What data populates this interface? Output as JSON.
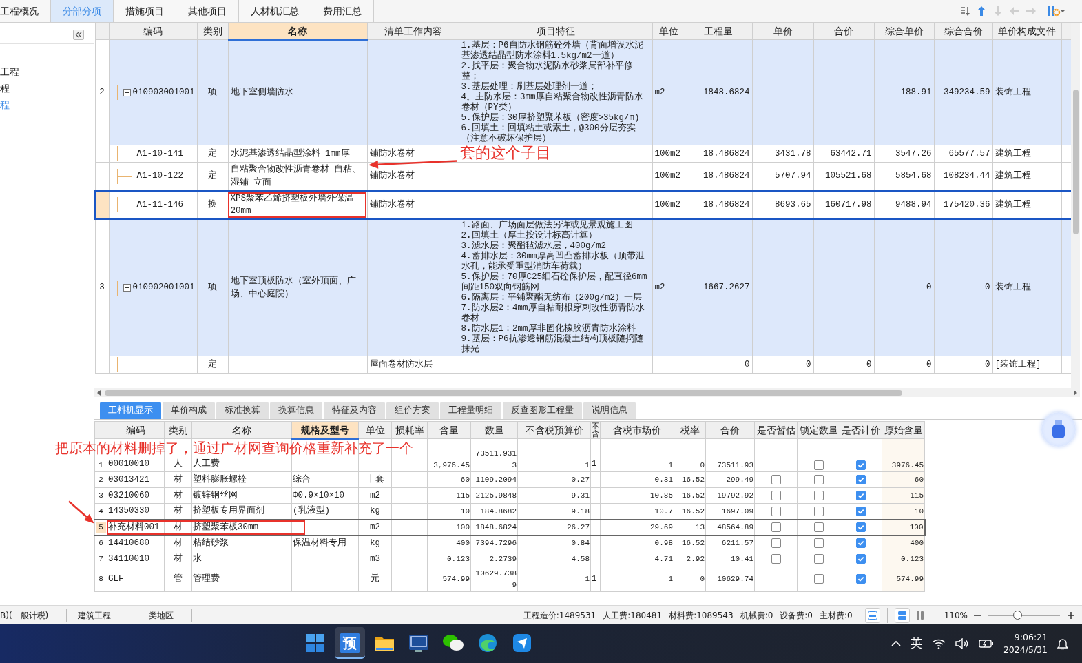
{
  "tabs": [
    {
      "label": "工程概况",
      "selected": false
    },
    {
      "label": "分部分项",
      "selected": true
    },
    {
      "label": "措施项目",
      "selected": false
    },
    {
      "label": "其他项目",
      "selected": false
    },
    {
      "label": "人材机汇总",
      "selected": false
    },
    {
      "label": "费用汇总",
      "selected": false
    }
  ],
  "toolbar": [
    {
      "kind": "sort"
    },
    {
      "kind": "up",
      "disabled": false
    },
    {
      "kind": "down",
      "disabled": true
    },
    {
      "kind": "left",
      "disabled": true
    },
    {
      "kind": "right",
      "disabled": true
    },
    {
      "kind": "settings"
    }
  ],
  "sidebar": {
    "items": [
      {
        "label": "工程",
        "selected": false
      },
      {
        "label": "程",
        "selected": false
      },
      {
        "label": "程",
        "selected": true
      }
    ]
  },
  "main_table": {
    "columns": [
      {
        "label": "编码",
        "highlighted": false
      },
      {
        "label": "类别",
        "highlighted": false
      },
      {
        "label": "名称",
        "highlighted": true
      },
      {
        "label": "清单工作内容",
        "highlighted": false
      },
      {
        "label": "项目特征",
        "highlighted": false
      },
      {
        "label": "单位",
        "highlighted": false
      },
      {
        "label": "工程量",
        "highlighted": false
      },
      {
        "label": "单价",
        "highlighted": false
      },
      {
        "label": "合价",
        "highlighted": false
      },
      {
        "label": "综合单价",
        "highlighted": false
      },
      {
        "label": "综合合价",
        "highlighted": false
      },
      {
        "label": "单价构成文件",
        "highlighted": false
      }
    ],
    "rows": [
      {
        "no": "2",
        "code": "010903001001",
        "type": "项",
        "name": "地下室侧墙防水",
        "features": [
          "1.基层：P6自防水钢筋砼外墙（背面增设水泥基渗透结晶型防水涂料1.5kg/m2一道）",
          "2.找平层：聚合物水泥防水砂浆局部补平修整；",
          "3.基层处理：刷基层处理剂一道；",
          "4。主防水层：3mm厚自粘聚合物改性沥青防水卷材（PY类）",
          "5.保护层：30厚挤塑聚苯板（密度>35kg/m)",
          "6.回填土：回填粘土或素土，@300分层夯实（注意不破坏保护层）"
        ],
        "unit": "m2",
        "qty": "1848.6824",
        "unit_total": "188.91",
        "total_total": "349234.59",
        "file": "装饰工程",
        "expanded": true,
        "selected": false,
        "children": [
          {
            "code": "A1-10-141",
            "type": "定",
            "name": "水泥基渗透结晶型涂料 1mm厚",
            "work": "铺防水卷材",
            "unit": "100m2",
            "qty": "18.486824",
            "price": "3431.78",
            "total": "63442.71",
            "unit_total": "3547.26",
            "total_total": "65577.57",
            "file": "建筑工程",
            "selected": false
          },
          {
            "code": "A1-10-122",
            "type": "定",
            "name": "自粘聚合物改性沥青卷材 自粘、湿铺 立面",
            "work": "铺防水卷材",
            "unit": "100m2",
            "qty": "18.486824",
            "price": "5707.94",
            "total": "105521.68",
            "unit_total": "5854.68",
            "total_total": "108234.44",
            "file": "建筑工程",
            "selected": false
          },
          {
            "code": "A1-11-146",
            "type": "换",
            "name": "XPS聚苯乙烯挤塑板外墙外保温 20mm",
            "work": "铺防水卷材",
            "unit": "100m2",
            "qty": "18.486824",
            "price": "8693.65",
            "total": "160717.98",
            "unit_total": "9488.94",
            "total_total": "175420.36",
            "file": "建筑工程",
            "selected": true
          }
        ]
      },
      {
        "no": "3",
        "code": "010902001001",
        "type": "项",
        "name": "地下室顶板防水（室外顶面、广场、中心庭院）",
        "features": [
          "1.路面、广场面层做法另详或见景观施工图",
          "2.回填土（厚土按设计标高计算）",
          "3.滤水层：聚酯毡滤水层，400g/m2",
          "4.蓄排水层：30mm厚高凹凸蓄排水板（顶带泄水孔，能承受重型消防车荷载）",
          "5.保护层：70厚C25细石砼保护层，配直径6mm间距150双向钢筋网",
          "6.隔离层：平铺聚酯无纺布（200g/m2）一层",
          "7.防水层2：4mm厚自粘耐根穿刺改性沥青防水卷材",
          "8.防水层1：2mm厚非固化橡胶沥青防水涂料",
          "9.基层：P6抗渗透钢筋混凝土结构顶板随捣随抹光"
        ],
        "unit": "m2",
        "qty": "1667.2627",
        "unit_total": "0",
        "total_total": "0",
        "file": "装饰工程",
        "expanded": true,
        "selected": false,
        "children": [
          {
            "type": "定",
            "work": "屋面卷材防水层",
            "qty": "0",
            "price": "0",
            "total": "0",
            "unit_total": "0",
            "total_total": "0",
            "file": "[装饰工程]",
            "selected": false
          }
        ]
      }
    ]
  },
  "annotations": [
    {
      "kind": "callout",
      "text": "套的这个子目"
    },
    {
      "kind": "callout",
      "text": "把原本的材料删掉了，通过广材网查询价格重新补充了一个"
    }
  ],
  "detail_tabs": [
    {
      "label": "工料机显示",
      "selected": true
    },
    {
      "label": "单价构成",
      "selected": false
    },
    {
      "label": "标准换算",
      "selected": false
    },
    {
      "label": "换算信息",
      "selected": false
    },
    {
      "label": "特征及内容",
      "selected": false
    },
    {
      "label": "组价方案",
      "selected": false
    },
    {
      "label": "工程量明细",
      "selected": false
    },
    {
      "label": "反查图形工程量",
      "selected": false
    },
    {
      "label": "说明信息",
      "selected": false
    }
  ],
  "detail_table": {
    "columns": [
      {
        "label": "编码",
        "highlighted": false
      },
      {
        "label": "类别",
        "highlighted": false
      },
      {
        "label": "名称",
        "highlighted": false
      },
      {
        "label": "规格及型号",
        "highlighted": true
      },
      {
        "label": "单位",
        "highlighted": false
      },
      {
        "label": "损耗率",
        "highlighted": false
      },
      {
        "label": "含量",
        "highlighted": false
      },
      {
        "label": "数量",
        "highlighted": false
      },
      {
        "label": "不含税预算价",
        "highlighted": false
      },
      {
        "label": "不含",
        "highlighted": false
      },
      {
        "label": "含税市场价",
        "highlighted": false
      },
      {
        "label": "税率",
        "highlighted": false
      },
      {
        "label": "合价",
        "highlighted": false
      },
      {
        "label": "是否暂估",
        "highlighted": false
      },
      {
        "label": "锁定数量",
        "highlighted": false
      },
      {
        "label": "是否计价",
        "highlighted": false
      },
      {
        "label": "原始含量",
        "highlighted": false
      }
    ],
    "rows": [
      {
        "no": "1",
        "code": "00010010",
        "type": "人",
        "name": "人工费",
        "content": "3,976.45",
        "qty": "73511.9313",
        "price_excl": "1",
        "flag": "1",
        "price_incl": "1",
        "tax": "0",
        "total": "73511.93",
        "locked": false,
        "priced": true,
        "original": "3976.45",
        "selected": false
      },
      {
        "no": "2",
        "code": "03013421",
        "type": "材",
        "name": "塑料膨胀螺栓",
        "spec": "综合",
        "unit": "十套",
        "content": "60",
        "qty": "1109.2094",
        "price_excl": "0.27",
        "price_incl": "0.31",
        "tax": "16.52",
        "total": "299.49",
        "provisional": false,
        "locked": false,
        "priced": true,
        "original": "60",
        "selected": false
      },
      {
        "no": "3",
        "code": "03210060",
        "type": "材",
        "name": "镀锌钢丝网",
        "spec": "Φ0.9×10×10",
        "unit": "m2",
        "content": "115",
        "qty": "2125.9848",
        "price_excl": "9.31",
        "price_incl": "10.85",
        "tax": "16.52",
        "total": "19792.92",
        "provisional": false,
        "locked": false,
        "priced": true,
        "original": "115",
        "selected": false
      },
      {
        "no": "4",
        "code": "14350330",
        "type": "材",
        "name": "挤塑板专用界面剂",
        "spec": "(乳液型)",
        "unit": "kg",
        "content": "10",
        "qty": "184.8682",
        "price_excl": "9.18",
        "price_incl": "10.7",
        "tax": "16.52",
        "total": "1697.09",
        "provisional": false,
        "locked": false,
        "priced": true,
        "original": "10",
        "selected": false
      },
      {
        "no": "5",
        "code": "补充材料001",
        "type": "材",
        "name": "挤塑聚苯板30mm",
        "unit": "m2",
        "content": "100",
        "qty": "1848.6824",
        "price_excl": "26.27",
        "price_incl": "29.69",
        "tax": "13",
        "total": "48564.89",
        "provisional": false,
        "locked": false,
        "priced": true,
        "original": "100",
        "selected": true
      },
      {
        "no": "6",
        "code": "14410680",
        "type": "材",
        "name": "粘结砂浆",
        "spec": "保温材料专用",
        "unit": "kg",
        "content": "400",
        "qty": "7394.7296",
        "price_excl": "0.84",
        "price_incl": "0.98",
        "tax": "16.52",
        "total": "6211.57",
        "provisional": false,
        "locked": false,
        "priced": true,
        "original": "400",
        "selected": false
      },
      {
        "no": "7",
        "code": "34110010",
        "type": "材",
        "name": "水",
        "unit": "m3",
        "content": "0.123",
        "qty": "2.2739",
        "price_excl": "4.58",
        "price_incl": "4.71",
        "tax": "2.92",
        "total": "10.41",
        "provisional": false,
        "locked": false,
        "priced": true,
        "original": "0.123",
        "selected": false
      },
      {
        "no": "8",
        "code": "GLF",
        "type": "管",
        "name": "管理费",
        "unit": "元",
        "content": "574.99",
        "qty": "10629.7389",
        "price_excl": "1",
        "flag": "1",
        "price_incl": "1",
        "tax": "0",
        "total": "10629.74",
        "locked": false,
        "priced": true,
        "original": "574.99",
        "selected": false
      }
    ]
  },
  "status_bar": {
    "project": [
      "B)(一般计税)",
      "建筑工程",
      "一类地区"
    ],
    "totals": [
      "工程造价:1489531",
      "人工费:180481",
      "材料费:1089543",
      "机械费:0",
      "设备费:0",
      "主材费:0"
    ],
    "zoom": "110%",
    "zoom_slider": {
      "level": 0.4
    }
  },
  "taskbar": {
    "apps": [
      {
        "kind": "start",
        "selected": false
      },
      {
        "kind": "estimate",
        "label": "预",
        "selected": true
      },
      {
        "kind": "folder",
        "selected": false
      },
      {
        "kind": "cad",
        "selected": false
      },
      {
        "kind": "chat",
        "selected": false
      },
      {
        "kind": "browser",
        "selected": false
      },
      {
        "kind": "app",
        "selected": false
      }
    ],
    "ime": "英",
    "time": "9:06:21",
    "date": "2024/5/31"
  }
}
